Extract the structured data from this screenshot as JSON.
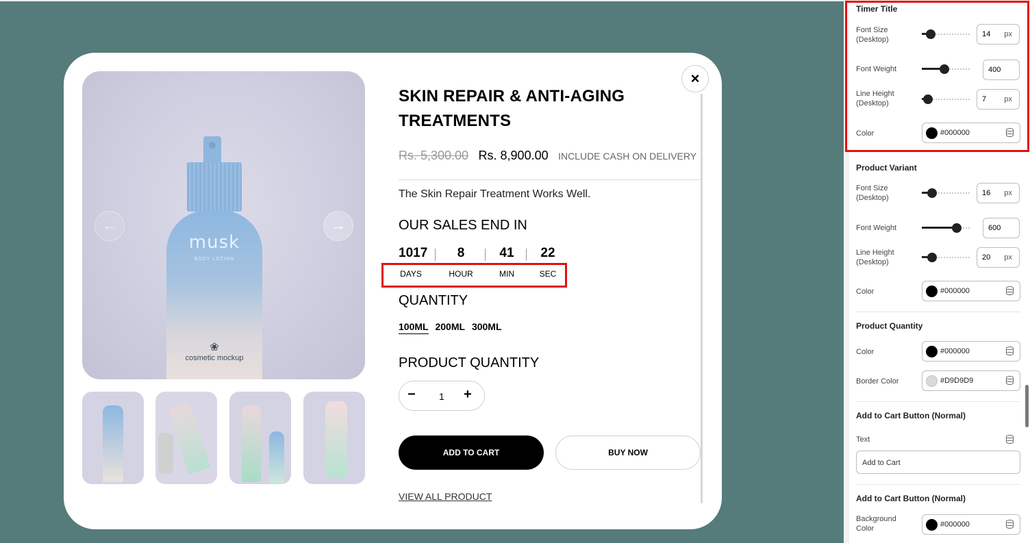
{
  "product": {
    "title": "SKIN REPAIR & ANTI-AGING TREATMENTS",
    "old_price": "Rs. 5,300.00",
    "new_price": "Rs. 8,900.00",
    "cod_note": "INCLUDE CASH ON DELIVERY",
    "description": "The Skin Repair Treatment Works Well.",
    "image_brand": "musk",
    "image_brand_sub": "BODY LOTION",
    "image_mock_text": "cosmetic mockup",
    "close_symbol": "×",
    "arrow_left": "←",
    "arrow_right": "→"
  },
  "timer": {
    "title": "OUR SALES END IN",
    "days": "1017",
    "hours": "8",
    "mins": "41",
    "secs": "22",
    "days_label": "DAYS",
    "hours_label": "HOUR",
    "mins_label": "MIN",
    "secs_label": "SEC"
  },
  "quantity": {
    "title": "QUANTITY",
    "variants": [
      "100ML",
      "200ML",
      "300ML"
    ],
    "selected": "100ML",
    "product_quantity_title": "PRODUCT QUANTITY",
    "minus": "−",
    "value": "1",
    "plus": "+"
  },
  "buttons": {
    "add_to_cart": "ADD TO CART",
    "buy_now": "BUY NOW",
    "view_all": "VIEW ALL PRODUCT"
  },
  "panel": {
    "timer_title": {
      "heading": "Timer Title",
      "font_size_label": "Font Size (Desktop)",
      "font_size_value": "14",
      "font_size_unit": "px",
      "font_weight_label": "Font Weight",
      "font_weight_value": "400",
      "line_height_label": "Line Height (Desktop)",
      "line_height_value": "7",
      "line_height_unit": "px",
      "color_label": "Color",
      "color_value": "#000000"
    },
    "product_variant": {
      "heading": "Product Variant",
      "font_size_label": "Font Size (Desktop)",
      "font_size_value": "16",
      "font_size_unit": "px",
      "font_weight_label": "Font Weight",
      "font_weight_value": "600",
      "line_height_label": "Line Height (Desktop)",
      "line_height_value": "20",
      "line_height_unit": "px",
      "color_label": "Color",
      "color_value": "#000000"
    },
    "product_quantity": {
      "heading": "Product Quantity",
      "color_label": "Color",
      "color_value": "#000000",
      "border_color_label": "Border Color",
      "border_color_value": "#D9D9D9"
    },
    "add_to_cart_text": {
      "heading": "Add to Cart Button (Normal)",
      "text_label": "Text",
      "text_value": "Add to Cart"
    },
    "add_to_cart_bg": {
      "heading": "Add to Cart Button (Normal)",
      "bg_label": "Background Color",
      "bg_value": "#000000"
    }
  },
  "colors": {
    "canvas_bg": "#567b7b",
    "highlight": "#e01010",
    "black_swatch": "#000000",
    "light_swatch": "#D9D9D9"
  }
}
